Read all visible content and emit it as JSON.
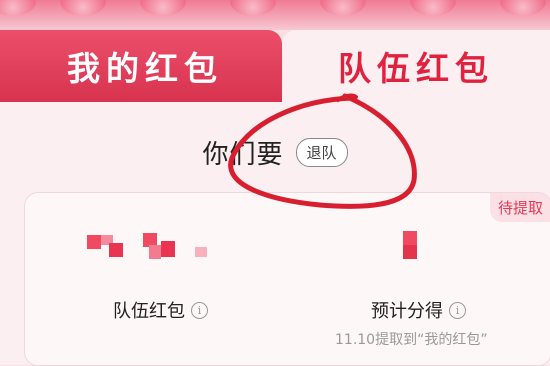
{
  "tabs": {
    "my_redpacket": "我的红包",
    "team_redpacket": "队伍红包"
  },
  "team": {
    "title": "你们要",
    "leave_label": "退队"
  },
  "card": {
    "badge": "待提取",
    "team_redpacket_label": "队伍红包",
    "expected_share_label": "预计分得",
    "withdraw_note": "11.10提取到“我的红包”",
    "info_glyph": "i"
  },
  "colors": {
    "accent": "#e0223e",
    "tab_active_bg": "#ec4f6a",
    "scribble": "#d81f2f"
  }
}
